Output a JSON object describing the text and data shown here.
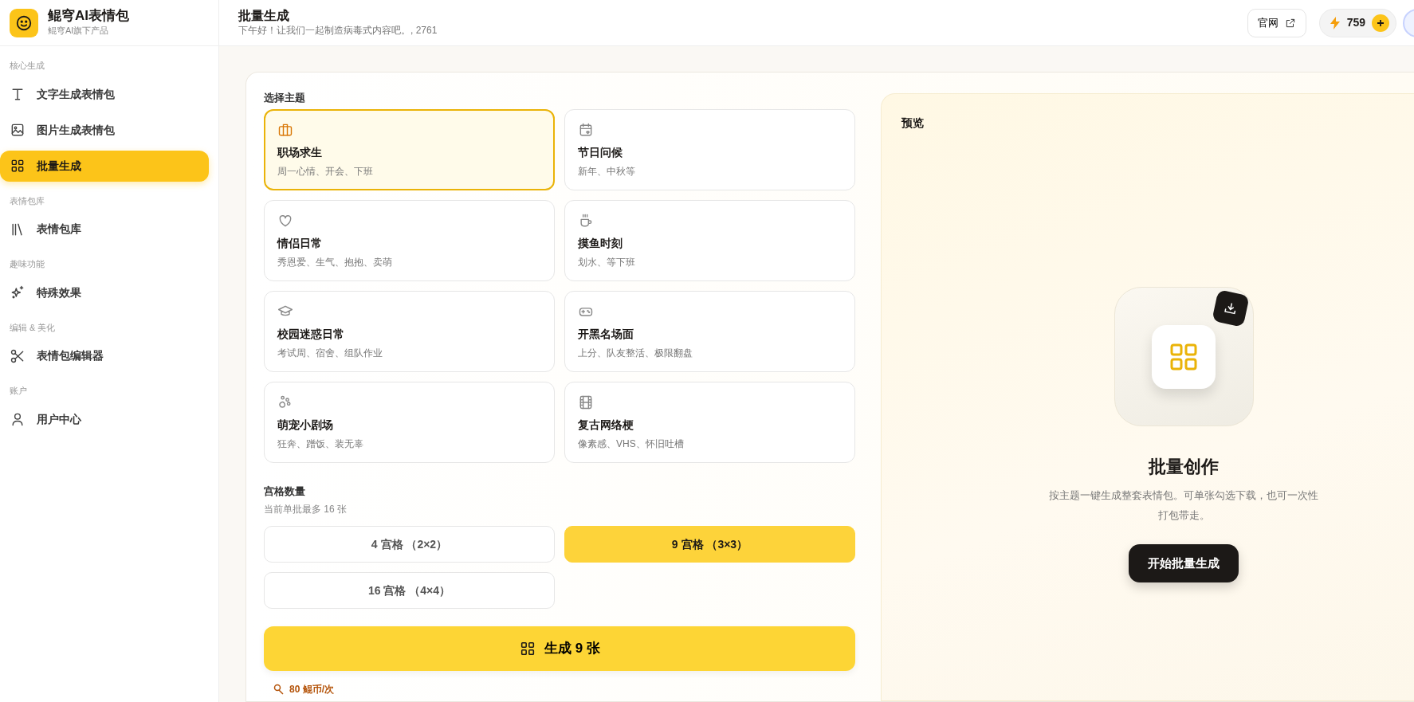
{
  "app": {
    "name": "鲲穹AI表情包",
    "tagline": "鲲穹AI旗下产品"
  },
  "sidebar": {
    "sections": [
      {
        "label": "核心生成",
        "items": [
          {
            "label": "文字生成表情包",
            "selected": false
          },
          {
            "label": "图片生成表情包",
            "selected": false
          },
          {
            "label": "批量生成",
            "selected": true
          }
        ]
      },
      {
        "label": "表情包库",
        "items": [
          {
            "label": "表情包库",
            "selected": false
          }
        ]
      },
      {
        "label": "趣味功能",
        "items": [
          {
            "label": "特殊效果",
            "selected": false
          }
        ]
      },
      {
        "label": "编辑 & 美化",
        "items": [
          {
            "label": "表情包编辑器",
            "selected": false
          }
        ]
      },
      {
        "label": "账户",
        "items": [
          {
            "label": "用户中心",
            "selected": false
          }
        ]
      }
    ]
  },
  "header": {
    "title": "批量生成",
    "subtitle": "下午好！让我们一起制造病毒式内容吧。, 2761",
    "site_link": "官网",
    "coins": "759"
  },
  "themes": {
    "label": "选择主题",
    "items": [
      {
        "title": "职场求生",
        "desc": "周一心情、开会、下班",
        "selected": true
      },
      {
        "title": "节日问候",
        "desc": "新年、中秋等",
        "selected": false
      },
      {
        "title": "情侣日常",
        "desc": "秀恩爱、生气、抱抱、卖萌",
        "selected": false
      },
      {
        "title": "摸鱼时刻",
        "desc": "划水、等下班",
        "selected": false
      },
      {
        "title": "校园迷惑日常",
        "desc": "考试周、宿舍、组队作业",
        "selected": false
      },
      {
        "title": "开黑名场面",
        "desc": "上分、队友整活、极限翻盘",
        "selected": false
      },
      {
        "title": "萌宠小剧场",
        "desc": "狂奔、蹭饭、装无辜",
        "selected": false
      },
      {
        "title": "复古网络梗",
        "desc": "像素感、VHS、怀旧吐槽",
        "selected": false
      }
    ]
  },
  "grid_count": {
    "label": "宫格数量",
    "hint": "当前单批最多 16 张",
    "options": [
      {
        "label": "4 宫格 （2×2）",
        "selected": false
      },
      {
        "label": "9 宫格 （3×3）",
        "selected": true
      },
      {
        "label": "16 宫格 （4×4）",
        "selected": false
      }
    ]
  },
  "generate_button": "生成 9 张",
  "cost": "80 鲲币/次",
  "preview": {
    "label": "预览",
    "title": "批量创作",
    "description": "按主题一键生成整套表情包。可单张勾选下载，也可一次性打包带走。",
    "button": "开始批量生成"
  }
}
